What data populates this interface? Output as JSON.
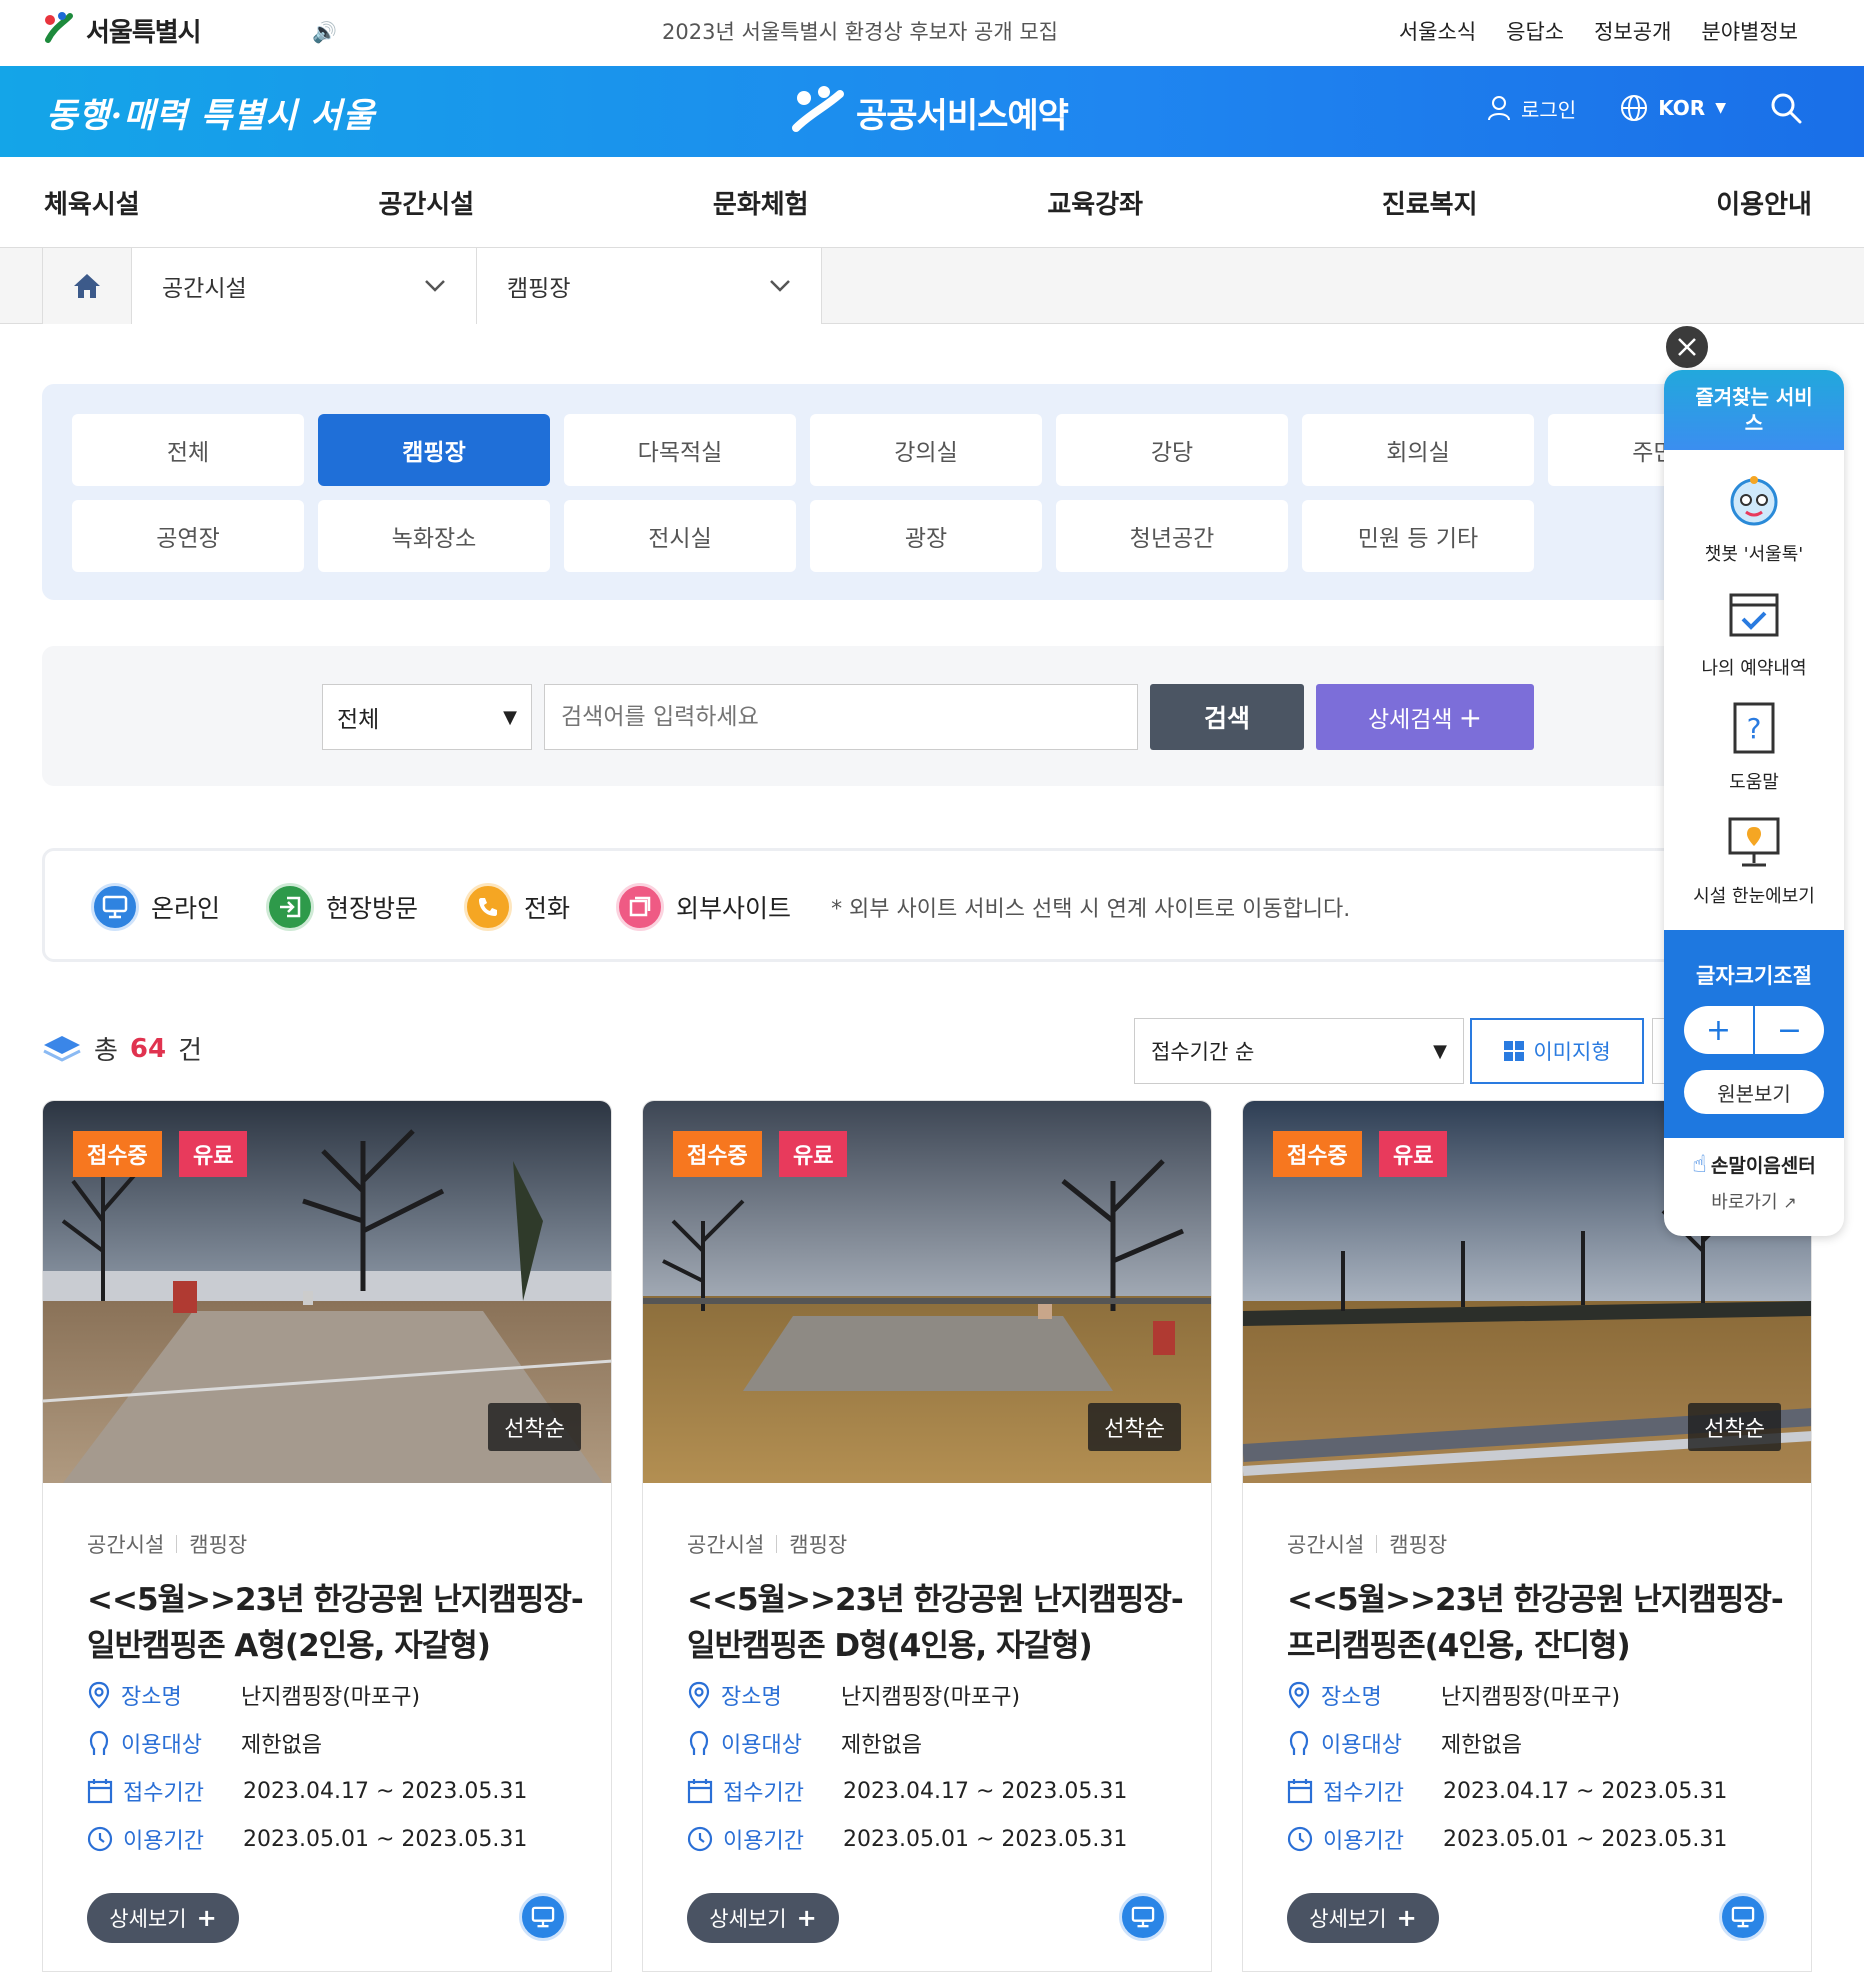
{
  "topbar": {
    "logo_text": "서울특별시",
    "notice": "2023년 서울특별시 환경상 후보자 공개 모집",
    "links": [
      "서울소식",
      "응답소",
      "정보공개",
      "분야별정보"
    ]
  },
  "header": {
    "slogan": "동행·매력 특별시 서울",
    "brand": "공공서비스예약",
    "login": "로그인",
    "language": "KOR"
  },
  "mainnav": [
    "체육시설",
    "공간시설",
    "문화체험",
    "교육강좌",
    "진료복지",
    "이용안내"
  ],
  "breadcrumb": {
    "level1": "공간시설",
    "level2": "캠핑장"
  },
  "categories": [
    {
      "label": "전체",
      "active": false
    },
    {
      "label": "캠핑장",
      "active": true
    },
    {
      "label": "다목적실",
      "active": false
    },
    {
      "label": "강의실",
      "active": false
    },
    {
      "label": "강당",
      "active": false
    },
    {
      "label": "회의실",
      "active": false
    },
    {
      "label": "주민공",
      "active": false
    },
    {
      "label": "공연장",
      "active": false
    },
    {
      "label": "녹화장소",
      "active": false
    },
    {
      "label": "전시실",
      "active": false
    },
    {
      "label": "광장",
      "active": false
    },
    {
      "label": "청년공간",
      "active": false
    },
    {
      "label": "민원 등 기타",
      "active": false
    }
  ],
  "search": {
    "scope": "전체",
    "placeholder": "검색어를 입력하세요",
    "button": "검색",
    "advanced": "상세검색",
    "advanced_mark": "+"
  },
  "legend": {
    "items": [
      "온라인",
      "현장방문",
      "전화",
      "외부사이트"
    ],
    "colors": [
      "#2f83e0",
      "#2e9a4a",
      "#f5a623",
      "#ef5a84"
    ],
    "note": "* 외부 사이트 서비스 선택 시 연계 사이트로 이동합니다."
  },
  "results": {
    "prefix": "총",
    "count": "64",
    "suffix": "건",
    "sort": "접수기간 순",
    "view_image": "이미지형"
  },
  "cards": [
    {
      "status": "접수중",
      "fee": "유료",
      "method": "선착순",
      "cat1": "공간시설",
      "cat2": "캠핑장",
      "title": "<<5월>>23년 한강공원 난지캠핑장-일반캠핑존 A형(2인용, 자갈형)",
      "place_label": "장소명",
      "place": "난지캠핑장(마포구)",
      "target_label": "이용대상",
      "target": "제한없음",
      "apply_label": "접수기간",
      "apply": "2023.04.17 ~ 2023.05.31",
      "use_label": "이용기간",
      "use": "2023.05.01 ~ 2023.05.31",
      "detail": "상세보기"
    },
    {
      "status": "접수중",
      "fee": "유료",
      "method": "선착순",
      "cat1": "공간시설",
      "cat2": "캠핑장",
      "title": "<<5월>>23년 한강공원 난지캠핑장-일반캠핑존 D형(4인용, 자갈형)",
      "place_label": "장소명",
      "place": "난지캠핑장(마포구)",
      "target_label": "이용대상",
      "target": "제한없음",
      "apply_label": "접수기간",
      "apply": "2023.04.17 ~ 2023.05.31",
      "use_label": "이용기간",
      "use": "2023.05.01 ~ 2023.05.31",
      "detail": "상세보기"
    },
    {
      "status": "접수중",
      "fee": "유료",
      "method": "선착순",
      "cat1": "공간시설",
      "cat2": "캠핑장",
      "title": "<<5월>>23년 한강공원 난지캠핑장-프리캠핑존(4인용, 잔디형)",
      "place_label": "장소명",
      "place": "난지캠핑장(마포구)",
      "target_label": "이용대상",
      "target": "제한없음",
      "apply_label": "접수기간",
      "apply": "2023.04.17 ~ 2023.05.31",
      "use_label": "이용기간",
      "use": "2023.05.01 ~ 2023.05.31",
      "detail": "상세보기"
    }
  ],
  "quick": {
    "title": "즐겨찾는 서비스",
    "items": [
      "챗봇 '서울톡'",
      "나의 예약내역",
      "도움말",
      "시설 한눈에보기"
    ],
    "font_title": "글자크기조절",
    "plus": "+",
    "minus": "−",
    "reset": "원본보기",
    "sign_center": "손말이음센터",
    "sign_go": "바로가기"
  }
}
